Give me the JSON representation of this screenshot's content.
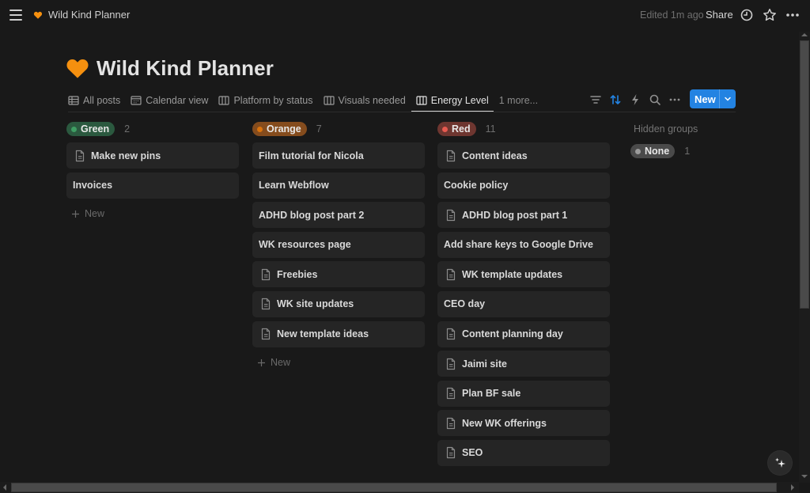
{
  "topbar": {
    "breadcrumb": "Wild Kind Planner",
    "edited": "Edited 1m ago",
    "share_label": "Share",
    "icons": [
      "menu-icon",
      "heart-icon",
      "clock-icon",
      "star-icon",
      "more-icon"
    ]
  },
  "page": {
    "title": "Wild Kind Planner",
    "icon": "orange-heart",
    "accent_color": "#f5900f"
  },
  "views": {
    "tabs": [
      {
        "label": "All posts",
        "icon": "table-icon",
        "active": false
      },
      {
        "label": "Calendar view",
        "icon": "calendar-icon",
        "active": false
      },
      {
        "label": "Platform by status",
        "icon": "board-icon",
        "active": false
      },
      {
        "label": "Visuals needed",
        "icon": "board-icon",
        "active": false
      },
      {
        "label": "Energy Level",
        "icon": "board-icon",
        "active": true
      }
    ],
    "more_label": "1 more...",
    "toolbar_icons": [
      "filter-icon",
      "sort-icon",
      "automation-icon",
      "search-icon",
      "more-icon"
    ],
    "new_label": "New",
    "new_color": "#2383e2",
    "sort_active_color": "#2383e2"
  },
  "board": {
    "groups": [
      {
        "name": "Green",
        "count": "2",
        "pill_bg": "#2b593f",
        "dot": "#3e9d63",
        "cards": [
          {
            "title": "Make new pins",
            "has_doc_icon": true
          },
          {
            "title": "Invoices",
            "has_doc_icon": false
          }
        ],
        "add_label": "New"
      },
      {
        "name": "Orange",
        "count": "7",
        "pill_bg": "#854c1d",
        "dot": "#d9730d",
        "cards": [
          {
            "title": "Film tutorial for Nicola",
            "has_doc_icon": false
          },
          {
            "title": "Learn Webflow",
            "has_doc_icon": false
          },
          {
            "title": "ADHD blog post part 2",
            "has_doc_icon": false
          },
          {
            "title": "WK resources page",
            "has_doc_icon": false
          },
          {
            "title": "Freebies",
            "has_doc_icon": true
          },
          {
            "title": "WK site updates",
            "has_doc_icon": true
          },
          {
            "title": "New template ideas",
            "has_doc_icon": true
          }
        ],
        "add_label": "New"
      },
      {
        "name": "Red",
        "count": "11",
        "pill_bg": "#6e3630",
        "dot": "#e65a50",
        "cards": [
          {
            "title": "Content ideas",
            "has_doc_icon": true
          },
          {
            "title": "Cookie policy",
            "has_doc_icon": false
          },
          {
            "title": "ADHD blog post part 1",
            "has_doc_icon": true
          },
          {
            "title": "Add share keys to Google Drive",
            "has_doc_icon": false
          },
          {
            "title": "WK template updates",
            "has_doc_icon": true
          },
          {
            "title": "CEO day",
            "has_doc_icon": false
          },
          {
            "title": "Content planning day",
            "has_doc_icon": true
          },
          {
            "title": "Jaimi site",
            "has_doc_icon": true
          },
          {
            "title": "Plan BF sale",
            "has_doc_icon": true
          },
          {
            "title": "New WK offerings",
            "has_doc_icon": true
          },
          {
            "title": "SEO",
            "has_doc_icon": true
          }
        ],
        "add_label": null
      }
    ],
    "hidden": {
      "label": "Hidden groups",
      "groups": [
        {
          "name": "None",
          "count": "1",
          "pill_bg": "#4a4a4a",
          "dot": "#9b9b9b"
        }
      ]
    }
  },
  "assistant_icon": "sparkle-icon"
}
